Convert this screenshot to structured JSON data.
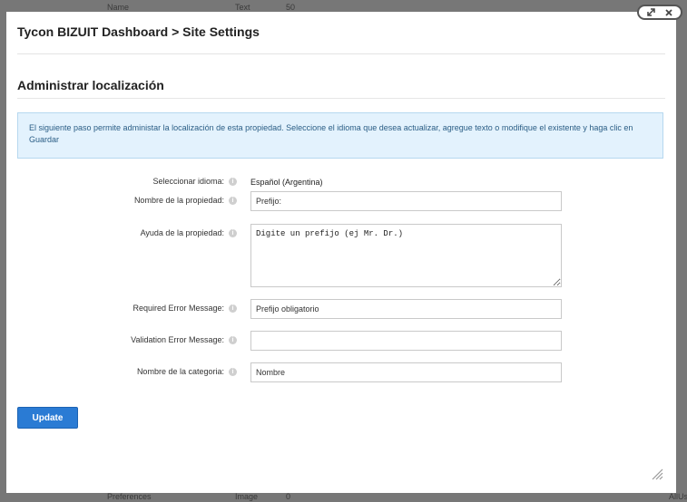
{
  "background": {
    "top_col1": "Name",
    "top_col2": "Text",
    "top_col3": "50",
    "bottom_col1": "Preferences",
    "bottom_col2": "Image",
    "bottom_col3": "0",
    "bottom_right": "AllUse"
  },
  "modal": {
    "title": "Tycon BIZUIT Dashboard > Site Settings",
    "section_title": "Administrar localización",
    "info_text": "El siguiente paso permite administar la localización de esta propiedad. Seleccione el idioma que desea actualizar, agregue texto o modifique el existente y haga clic en Guardar",
    "update_label": "Update"
  },
  "form": {
    "language": {
      "label": "Seleccionar idioma:",
      "value": "Español (Argentina)"
    },
    "property_name": {
      "label": "Nombre de la propiedad:",
      "value": "Prefijo:"
    },
    "property_help": {
      "label": "Ayuda de la propiedad:",
      "value": "Digite un prefijo (ej Mr. Dr.)"
    },
    "required_error": {
      "label": "Required Error Message:",
      "value": "Prefijo obligatorio"
    },
    "validation_error": {
      "label": "Validation Error Message:",
      "value": ""
    },
    "category_name": {
      "label": "Nombre de la categoria:",
      "value": "Nombre"
    }
  },
  "icons": {
    "help": "info-icon",
    "expand": "expand-icon",
    "close": "close-icon",
    "resize": "resize-grip-icon"
  },
  "colors": {
    "primary_button": "#2a7bd4",
    "info_background": "#e3f2fd",
    "info_text": "#2a5d85"
  }
}
